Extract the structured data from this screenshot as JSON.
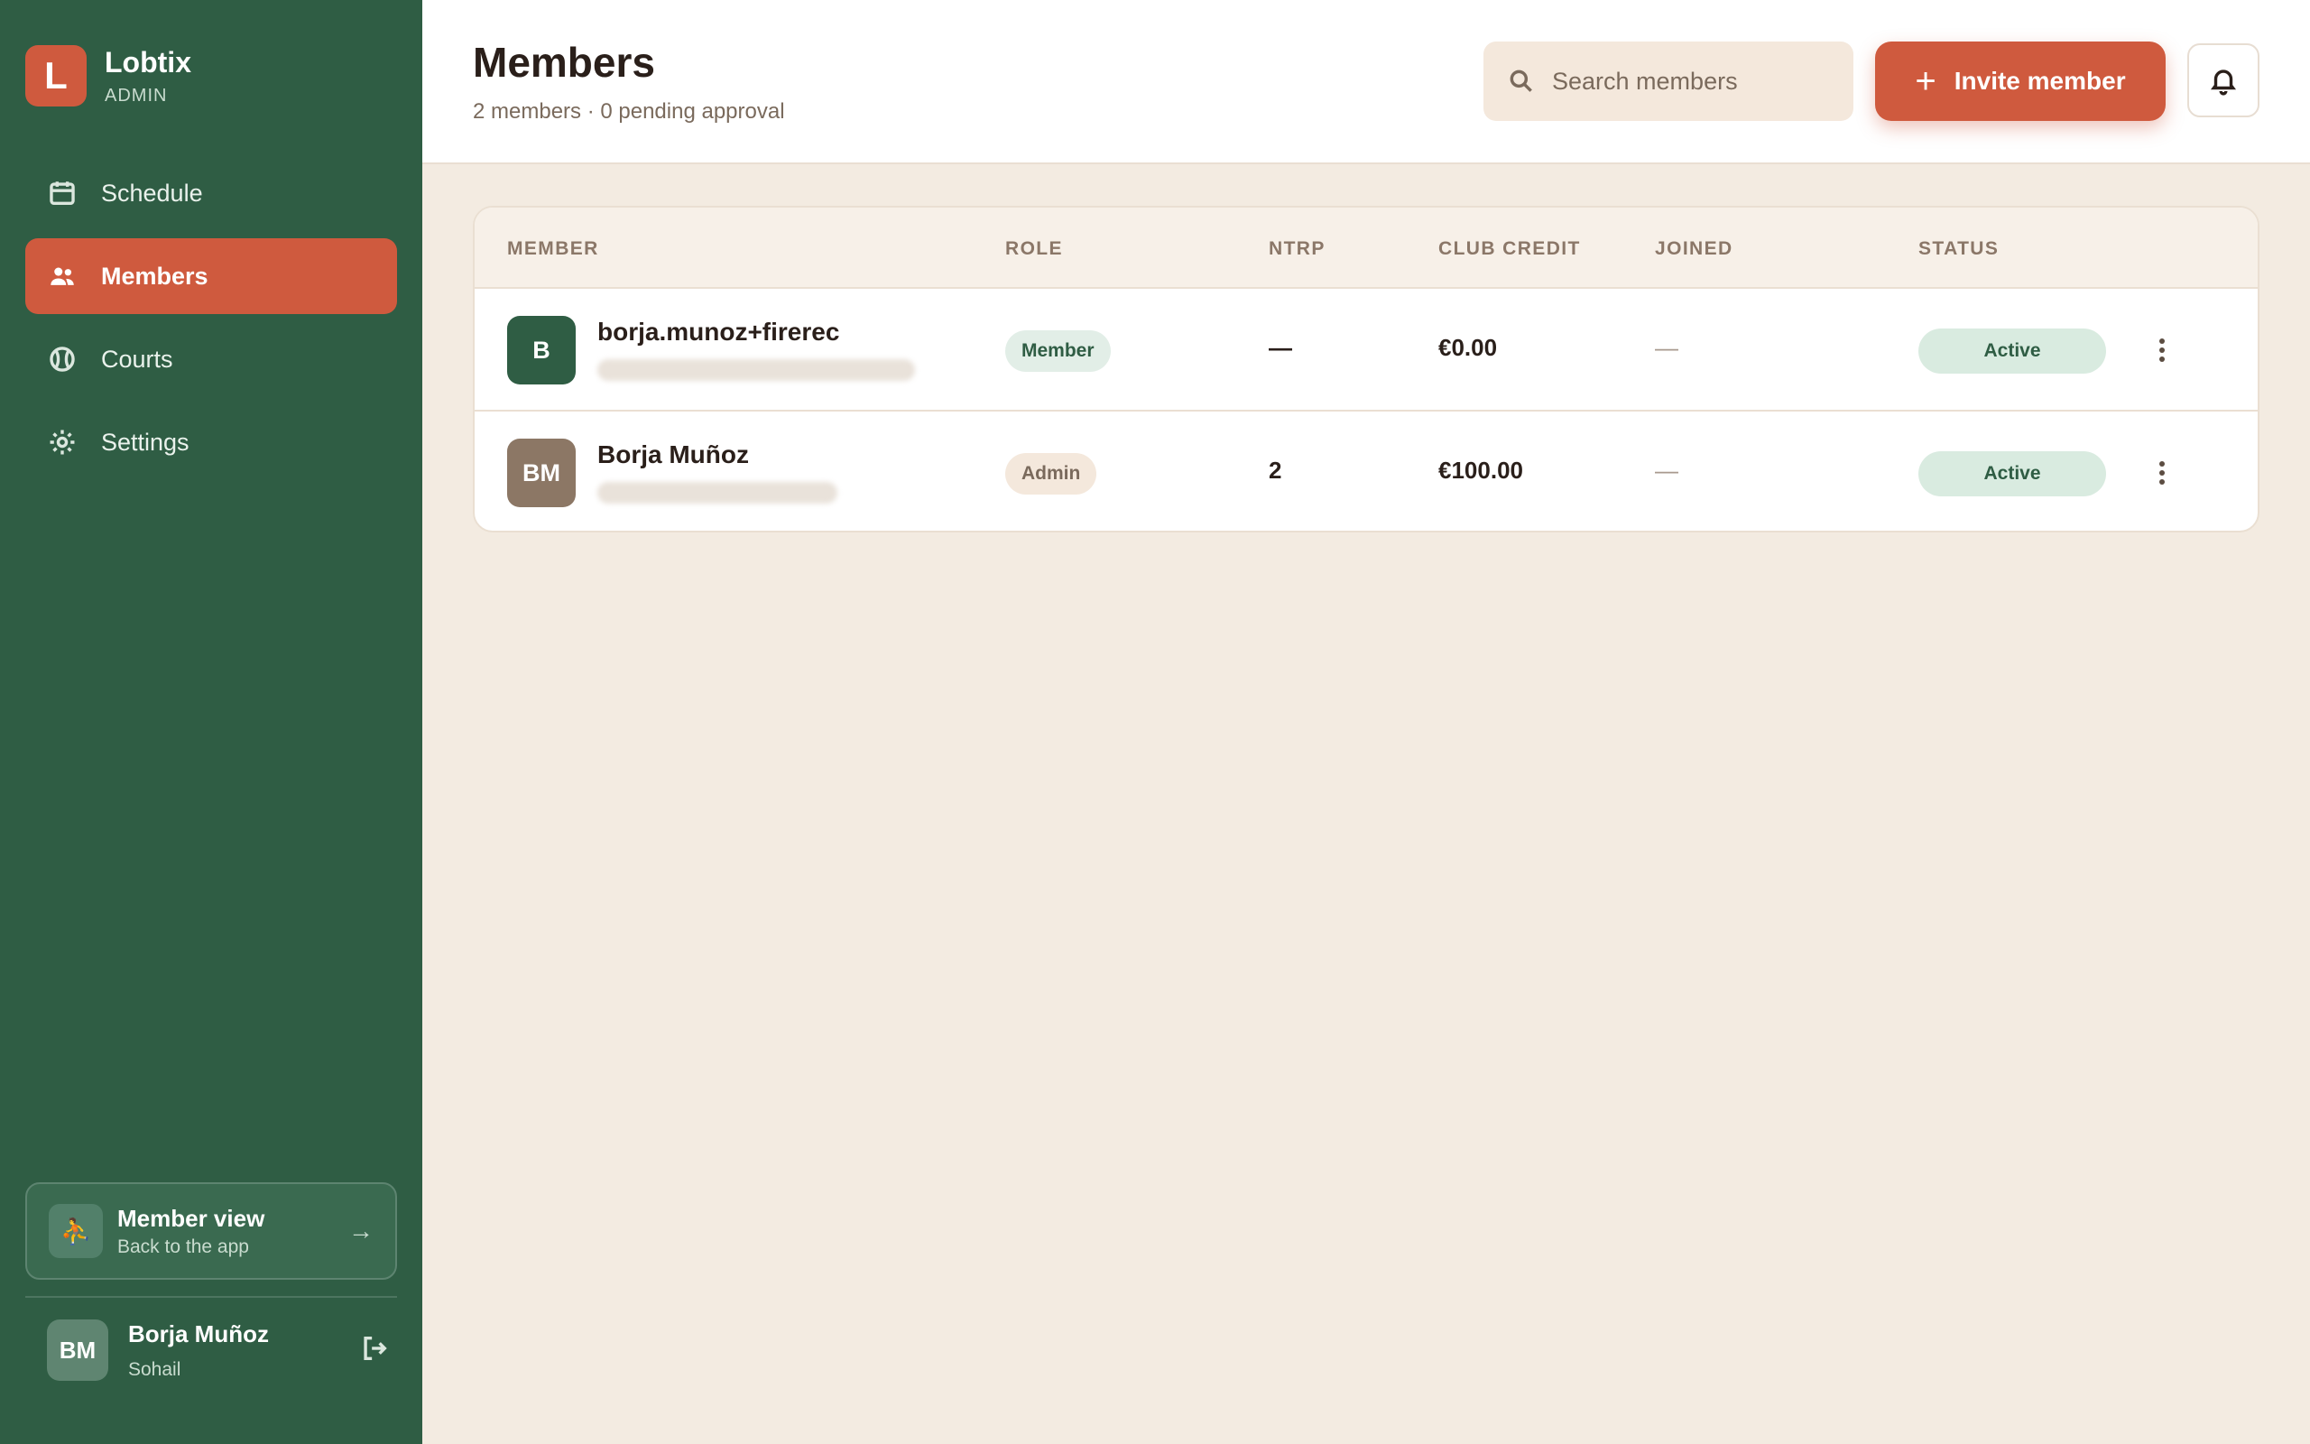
{
  "brand": {
    "logo_letter": "L",
    "name": "Lobtix",
    "subtitle": "ADMIN"
  },
  "sidebar": {
    "items": [
      {
        "label": "Schedule",
        "icon": "calendar-icon",
        "active": false
      },
      {
        "label": "Members",
        "icon": "people-icon",
        "active": true
      },
      {
        "label": "Courts",
        "icon": "ball-icon",
        "active": false
      },
      {
        "label": "Settings",
        "icon": "gear-icon",
        "active": false
      }
    ],
    "member_view": {
      "title": "Member view",
      "subtitle": "Back to the app",
      "icon": "person-icon",
      "arrow": "→"
    },
    "user": {
      "initials": "BM",
      "name": "Borja Muñoz",
      "subtitle": "Sohail"
    }
  },
  "header": {
    "title": "Members",
    "subtitle": "2 members · 0 pending approval",
    "search_placeholder": "Search members",
    "invite_label": "Invite member",
    "invite_plus": "+"
  },
  "table": {
    "columns": [
      "MEMBER",
      "ROLE",
      "NTRP",
      "CLUB CREDIT",
      "JOINED",
      "STATUS"
    ],
    "rows": [
      {
        "initials": "B",
        "name": "borja.munoz+firerec",
        "role": "Member",
        "ntrp": "—",
        "credit": "€0.00",
        "joined": "—",
        "status": "Active",
        "avatar_color": "#2f5d44"
      },
      {
        "initials": "BM",
        "name": "Borja Muñoz",
        "role": "Admin",
        "ntrp": "2",
        "credit": "€100.00",
        "joined": "—",
        "status": "Active",
        "avatar_color": "#8c7765"
      }
    ]
  },
  "colors": {
    "sidebar": "#2f5d44",
    "accent": "#cf5a3e",
    "background": "#f3ebe1",
    "status_active_bg": "#d9ebe0"
  }
}
